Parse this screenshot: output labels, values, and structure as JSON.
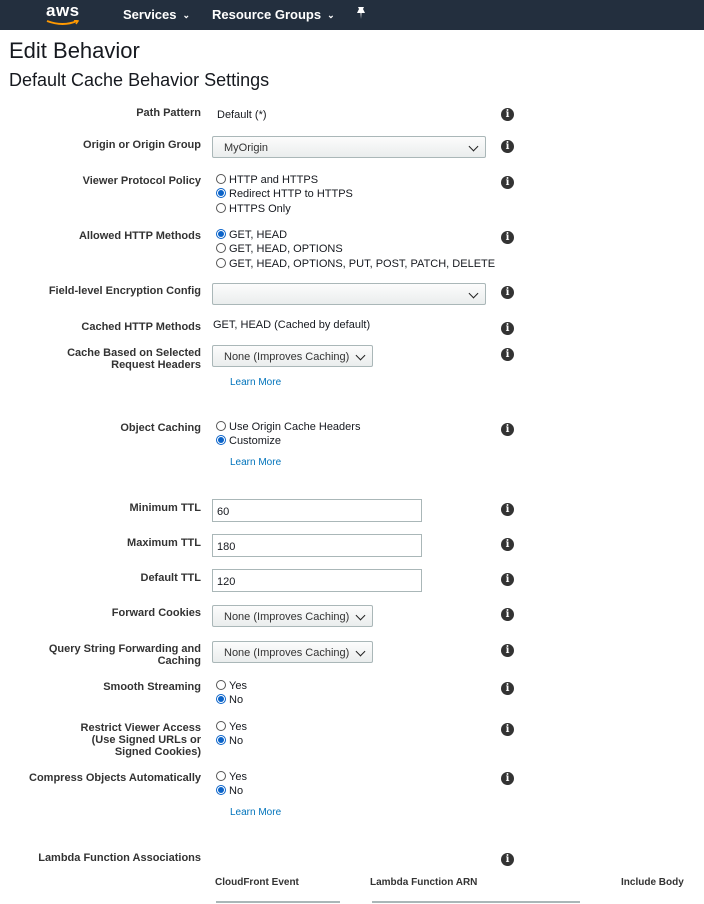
{
  "nav": {
    "logo": "aws",
    "services": "Services",
    "resource_groups": "Resource Groups"
  },
  "page_title": "Edit Behavior",
  "section_title": "Default Cache Behavior Settings",
  "form": {
    "path_pattern": {
      "label": "Path Pattern",
      "value": "Default (*)"
    },
    "origin": {
      "label": "Origin or Origin Group",
      "selected": "MyOrigin"
    },
    "viewer_protocol": {
      "label": "Viewer Protocol Policy",
      "options": [
        "HTTP and HTTPS",
        "Redirect HTTP to HTTPS",
        "HTTPS Only"
      ],
      "selected_index": 1
    },
    "allowed_methods": {
      "label": "Allowed HTTP Methods",
      "options": [
        "GET, HEAD",
        "GET, HEAD, OPTIONS",
        "GET, HEAD, OPTIONS, PUT, POST, PATCH, DELETE"
      ],
      "selected_index": 0
    },
    "field_encryption": {
      "label": "Field-level Encryption Config",
      "selected": ""
    },
    "cached_methods": {
      "label": "Cached HTTP Methods",
      "value": "GET, HEAD (Cached by default)"
    },
    "cache_headers": {
      "label_line1": "Cache Based on Selected",
      "label_line2": "Request Headers",
      "selected": "None (Improves Caching)",
      "learn_more": "Learn More"
    },
    "object_caching": {
      "label": "Object Caching",
      "options": [
        "Use Origin Cache Headers",
        "Customize"
      ],
      "selected_index": 1,
      "learn_more": "Learn More"
    },
    "min_ttl": {
      "label": "Minimum TTL",
      "value": "60"
    },
    "max_ttl": {
      "label": "Maximum TTL",
      "value": "180"
    },
    "default_ttl": {
      "label": "Default TTL",
      "value": "120"
    },
    "forward_cookies": {
      "label": "Forward Cookies",
      "selected": "None (Improves Caching)"
    },
    "query_string": {
      "label_line1": "Query String Forwarding and",
      "label_line2": "Caching",
      "selected": "None (Improves Caching)"
    },
    "smooth_streaming": {
      "label": "Smooth Streaming",
      "options": [
        "Yes",
        "No"
      ],
      "selected_index": 1
    },
    "restrict_viewer": {
      "label_line1": "Restrict Viewer Access",
      "label_line2": "(Use Signed URLs or",
      "label_line3": "Signed Cookies)",
      "options": [
        "Yes",
        "No"
      ],
      "selected_index": 1
    },
    "compress": {
      "label": "Compress Objects Automatically",
      "options": [
        "Yes",
        "No"
      ],
      "selected_index": 1,
      "learn_more": "Learn More"
    },
    "lambda": {
      "label": "Lambda Function Associations",
      "columns": [
        "CloudFront Event",
        "Lambda Function ARN",
        "Include Body"
      ]
    }
  },
  "info_glyph": "i"
}
